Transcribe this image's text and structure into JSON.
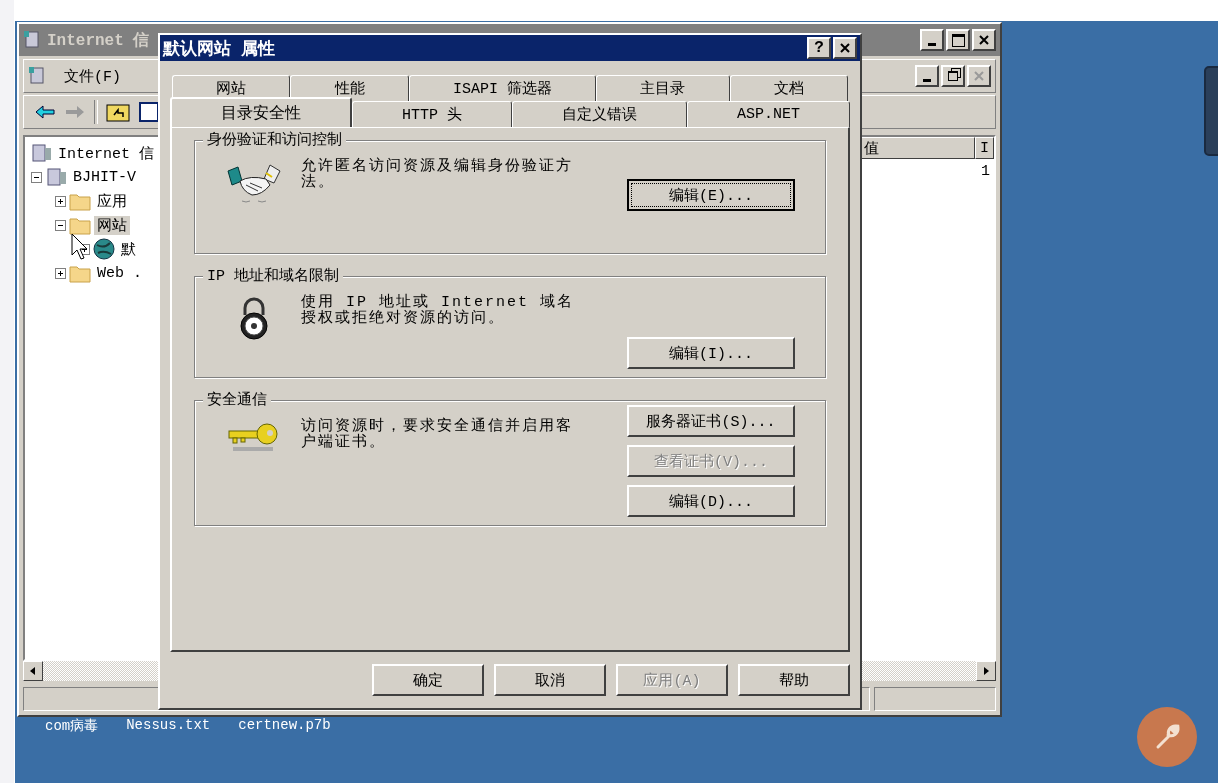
{
  "desktop_icons": [
    {
      "label": "com病毒"
    },
    {
      "label": "Nessus.txt"
    },
    {
      "label": "certnew.p7b"
    }
  ],
  "mmc": {
    "title": "Internet 信",
    "menu": [
      "文件(F)"
    ],
    "tree": [
      {
        "label": "Internet 信",
        "selected": false,
        "children": [
          {
            "label": "BJHIT-V",
            "selected": false,
            "expanded": true,
            "children": [
              {
                "label": "应用",
                "selected": false,
                "expanded": false
              },
              {
                "label": "网站",
                "selected": true,
                "expanded": true,
                "children": [
                  {
                    "label": "默",
                    "selected": false,
                    "expanded": false
                  }
                ]
              },
              {
                "label": "Web .",
                "selected": false,
                "expanded": false
              }
            ]
          }
        ]
      }
    ],
    "columns": [
      "值",
      "I"
    ],
    "rows": [
      [
        "",
        "1"
      ]
    ]
  },
  "dialog": {
    "title": "默认网站 属性",
    "help_button": "?",
    "tab_rows": [
      [
        {
          "label": "网站",
          "selected": false
        },
        {
          "label": "性能",
          "selected": false
        },
        {
          "label": "ISAPI 筛选器",
          "selected": false
        },
        {
          "label": "主目录",
          "selected": false
        },
        {
          "label": "文档",
          "selected": false
        }
      ],
      [
        {
          "label": "目录安全性",
          "selected": true
        },
        {
          "label": "HTTP 头",
          "selected": false
        },
        {
          "label": "自定义错误",
          "selected": false
        },
        {
          "label": "ASP.NET",
          "selected": false
        }
      ]
    ],
    "groups": [
      {
        "title": "身份验证和访问控制",
        "kind": "handshake",
        "text": "允许匿名访问资源及编辑身份验证方法。",
        "buttons": [
          {
            "label": "编辑(E)...",
            "disabled": false,
            "focused": true
          }
        ]
      },
      {
        "title": "IP 地址和域名限制",
        "kind": "lock",
        "text": "使用 IP 地址或 Internet 域名授权或拒绝对资源的访问。",
        "buttons": [
          {
            "label": "编辑(I)...",
            "disabled": false,
            "focused": false
          }
        ]
      },
      {
        "title": "安全通信",
        "kind": "key",
        "text": "访问资源时，要求安全通信并启用客户端证书。",
        "buttons": [
          {
            "label": "服务器证书(S)...",
            "disabled": false,
            "focused": false
          },
          {
            "label": "查看证书(V)...",
            "disabled": true,
            "focused": false
          },
          {
            "label": "编辑(D)...",
            "disabled": false,
            "focused": false
          }
        ]
      }
    ],
    "buttons": [
      {
        "label": "确定",
        "disabled": false
      },
      {
        "label": "取消",
        "disabled": false
      },
      {
        "label": "应用(A)",
        "disabled": true
      },
      {
        "label": "帮助",
        "disabled": false
      }
    ]
  }
}
